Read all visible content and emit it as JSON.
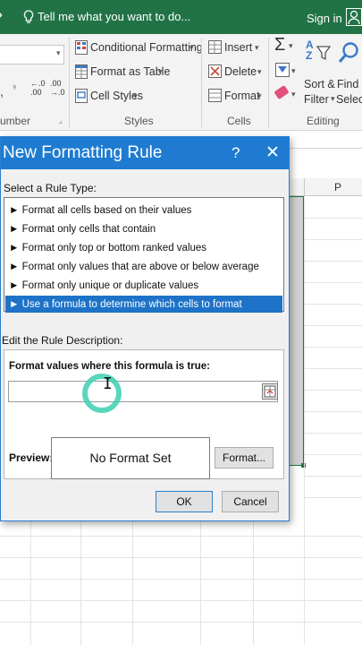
{
  "titlebar": {
    "tell_me": "Tell me what you want to do...",
    "sign_in": "Sign in"
  },
  "ribbon": {
    "styles": {
      "conditional_formatting": "Conditional Formatting",
      "format_as_table": "Format as Table",
      "cell_styles": "Cell Styles",
      "group": "Styles"
    },
    "cells": {
      "insert": "Insert",
      "delete": "Delete",
      "format": "Format",
      "group": "Cells"
    },
    "editing": {
      "sort_filter_1": "Sort &",
      "sort_filter_2": "Filter",
      "find_select_1": "Find &",
      "find_select_2": "Select",
      "group": "Editing"
    },
    "number": {
      "group": "umber",
      "inc_decimal": "←.0\n.00",
      "dec_decimal": ".00\n→.0"
    }
  },
  "sheet": {
    "column_p": "P"
  },
  "dialog": {
    "title": "New Formatting Rule",
    "help": "?",
    "close": "✕",
    "select_rule_type": "Select a Rule Type:",
    "rule_types": [
      "► Format all cells based on their values",
      "► Format only cells that contain",
      "► Format only top or bottom ranked values",
      "► Format only values that are above or below average",
      "► Format only unique or duplicate values",
      "► Use a formula to determine which cells to format"
    ],
    "selected_index": 5,
    "edit_rule_description": "Edit the Rule Description:",
    "formula_label": "Format values where this formula is true:",
    "formula_value": "",
    "preview_label": "Preview:",
    "preview_text": "No Format Set",
    "format_button": "Format...",
    "ok": "OK",
    "cancel": "Cancel"
  },
  "colors": {
    "excel_green": "#217346",
    "dialog_blue": "#1e7bd1",
    "selection_blue": "#1e73c8",
    "cursor_ring": "#3ccfb0"
  }
}
